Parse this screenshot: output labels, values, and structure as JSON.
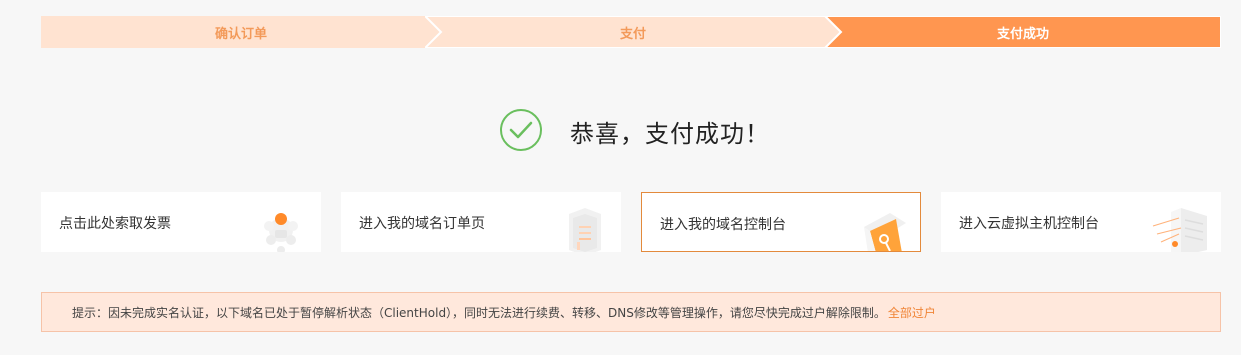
{
  "steps": [
    {
      "label": "确认订单"
    },
    {
      "label": "支付"
    },
    {
      "label": "支付成功"
    }
  ],
  "colors": {
    "step_inactive_bg": "#ffe3d1",
    "step_active_bg": "#ff9650",
    "step_inactive_text": "#f39a5a",
    "accent": "#f08537",
    "success_green": "#6abf5e"
  },
  "success": {
    "icon": "check-circle-icon",
    "message": "恭喜，支付成功！"
  },
  "cards": [
    {
      "label": "点击此处索取发票",
      "icon": "invoice-robot-icon"
    },
    {
      "label": "进入我的域名订单页",
      "icon": "order-stack-icon"
    },
    {
      "label": "进入我的域名控制台",
      "icon": "console-key-icon"
    },
    {
      "label": "进入云虚拟主机控制台",
      "icon": "server-stack-icon"
    }
  ],
  "notice": {
    "text": "提示：因未完成实名认证，以下域名已处于暂停解析状态（ClientHold），同时无法进行续费、转移、DNS修改等管理操作，请您尽快完成过户解除限制。",
    "link_label": "全部过户"
  }
}
